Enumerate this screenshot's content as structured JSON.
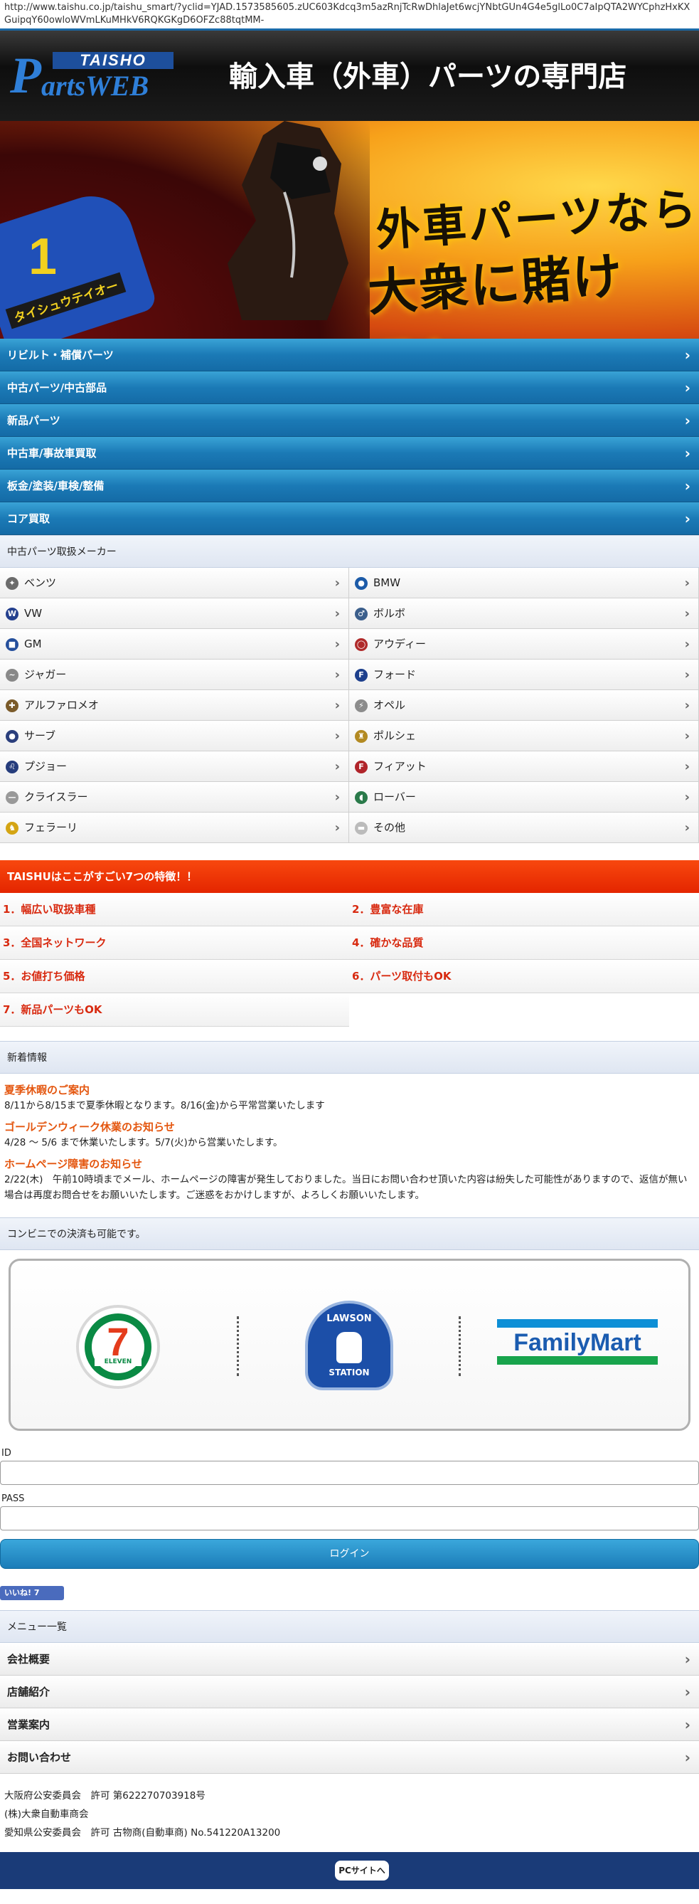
{
  "browser": {
    "url": "http://www.taishu.co.jp/taishu_smart/?yclid=YJAD.1573585605.zUC603Kdcq3m5azRnjTcRwDhlaJet6wcjYNbtGUn4G4e5glLo0C7aIpQTA2WYCphzHxKXGuipqY60owloWVmLKuMHkV6RQKGKgD6OFZc88tqtMM-"
  },
  "header": {
    "logo_top": "TAISHO",
    "logo_p": "P",
    "logo_rest": "artsWEB",
    "tagline": "輸入車（外車）パーツの専門店"
  },
  "hero": {
    "line1": "外車パーツなら",
    "line2": "大衆に賭けろ!",
    "blanket_number": "1",
    "blanket_name": "タイシュウテイオー"
  },
  "category_nav": [
    {
      "label": "リビルト・補償パーツ"
    },
    {
      "label": "中古パーツ/中古部品"
    },
    {
      "label": "新品パーツ"
    },
    {
      "label": "中古車/事故車買取"
    },
    {
      "label": "板金/塗装/車検/整備"
    },
    {
      "label": "コア買取"
    }
  ],
  "makers": {
    "heading": "中古パーツ取扱メーカー",
    "items": [
      {
        "label": "ベンツ",
        "icon": "mercedes-icon",
        "color": "#6b6b6b"
      },
      {
        "label": "BMW",
        "icon": "bmw-icon",
        "color": "#1c5ba8"
      },
      {
        "label": "VW",
        "icon": "vw-icon",
        "color": "#24408e"
      },
      {
        "label": "ボルボ",
        "icon": "volvo-icon",
        "color": "#3c5f8c"
      },
      {
        "label": "GM",
        "icon": "gm-icon",
        "color": "#254f9c"
      },
      {
        "label": "アウディー",
        "icon": "audi-icon",
        "color": "#b02a2a"
      },
      {
        "label": "ジャガー",
        "icon": "jaguar-icon",
        "color": "#888888"
      },
      {
        "label": "フォード",
        "icon": "ford-icon",
        "color": "#1d3f8c"
      },
      {
        "label": "アルファロメオ",
        "icon": "alfa-romeo-icon",
        "color": "#7b5b2a"
      },
      {
        "label": "オペル",
        "icon": "opel-icon",
        "color": "#8c8c8c"
      },
      {
        "label": "サーブ",
        "icon": "saab-icon",
        "color": "#2b3f7c"
      },
      {
        "label": "ポルシェ",
        "icon": "porsche-icon",
        "color": "#b38a22"
      },
      {
        "label": "プジョー",
        "icon": "peugeot-icon",
        "color": "#263d7c"
      },
      {
        "label": "フィアット",
        "icon": "fiat-icon",
        "color": "#b0242a"
      },
      {
        "label": "クライスラー",
        "icon": "chrysler-icon",
        "color": "#999999"
      },
      {
        "label": "ローバー",
        "icon": "rover-icon",
        "color": "#2a7a4a"
      },
      {
        "label": "フェラーリ",
        "icon": "ferrari-icon",
        "color": "#d4a514"
      },
      {
        "label": "その他",
        "icon": "other-icon",
        "color": "#bbbbbb"
      }
    ]
  },
  "features": {
    "heading": "TAISHUはここがすごい7つの特徴！！",
    "items": [
      {
        "label": "1．幅広い取扱車種"
      },
      {
        "label": "2．豊富な在庫"
      },
      {
        "label": "3．全国ネットワーク"
      },
      {
        "label": "4．確かな品質"
      },
      {
        "label": "5．お値打ち価格"
      },
      {
        "label": "6．パーツ取付もOK"
      },
      {
        "label": "7．新品パーツもOK"
      }
    ]
  },
  "news": {
    "heading": "新着情報",
    "items": [
      {
        "title": "夏季休暇のご案内",
        "body": "8/11から8/15まで夏季休暇となります。8/16(金)から平常営業いたします"
      },
      {
        "title": "ゴールデンウィーク休業のお知らせ",
        "body": "4/28 ～ 5/6 まで休業いたします。5/7(火)から営業いたします。"
      },
      {
        "title": "ホームページ障害のお知らせ",
        "body": "2/22(木)　午前10時頃までメール、ホームページの障害が発生しておりました。当日にお問い合わせ頂いた内容は紛失した可能性がありますので、返信が無い場合は再度お問合せをお願いいたします。ご迷惑をおかけしますが、よろしくお願いいたします。"
      }
    ]
  },
  "payment": {
    "heading": "コンビニでの決済も可能です。",
    "seven_number": "7",
    "seven_band": "ELEVEN",
    "lawson_top": "LAWSON",
    "lawson_bottom": "STATION",
    "familymart": "FamilyMart"
  },
  "login": {
    "id_label": "ID",
    "id_value": "",
    "pass_label": "PASS",
    "pass_value": "",
    "button": "ログイン"
  },
  "social": {
    "like_label": "いいね! 7"
  },
  "menu": {
    "heading": "メニュー一覧",
    "items": [
      {
        "label": "会社概要"
      },
      {
        "label": "店舗紹介"
      },
      {
        "label": "営業案内"
      },
      {
        "label": "お問い合わせ"
      }
    ]
  },
  "footer": {
    "line1": "大阪府公安委員会　許可 第622270703918号",
    "line2": "(株)大衆自動車商会",
    "line3": "愛知県公安委員会　許可 古物商(自動車商) No.541220A13200",
    "pc_button": "PCサイトへ"
  }
}
